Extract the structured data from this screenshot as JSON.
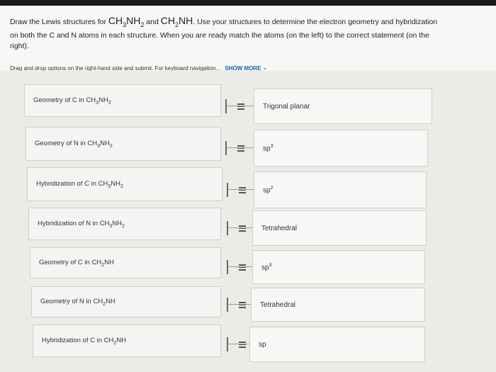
{
  "question": {
    "part1": "Draw the Lewis structures for ",
    "formula1_a": "CH",
    "formula1_sub1": "3",
    "formula1_b": "NH",
    "formula1_sub2": "2",
    "and": " and ",
    "formula2_a": "CH",
    "formula2_sub1": "2",
    "formula2_b": "NH",
    "part2": ". Use your structures to determine the electron geometry and hybridization on both the C and N atoms in each structure. When you are ready match the atoms (on the left) to the correct statement (on the right)."
  },
  "instructions": {
    "text": "Drag and drop options on the right-hand side and submit. For keyboard navigation...",
    "show_more": "SHOW MORE"
  },
  "rows": [
    {
      "label_pre": "Geometry of C in CH",
      "s1": "3",
      "mid": "NH",
      "s2": "2",
      "option": "Trigonal planar",
      "sup": ""
    },
    {
      "label_pre": "Geometry of N in CH",
      "s1": "3",
      "mid": "NH",
      "s2": "2",
      "option": "sp",
      "sup": "3"
    },
    {
      "label_pre": "Hybridization of C in CH",
      "s1": "3",
      "mid": "NH",
      "s2": "2",
      "option": "sp",
      "sup": "2"
    },
    {
      "label_pre": "Hybridization of N in CH",
      "s1": "3",
      "mid": "NH",
      "s2": "2",
      "option": "Tetrahedral",
      "sup": ""
    },
    {
      "label_pre": "Geometry of C in CH",
      "s1": "2",
      "mid": "NH",
      "s2": "",
      "option": "sp",
      "sup": "3"
    },
    {
      "label_pre": "Geometry of N in CH",
      "s1": "2",
      "mid": "NH",
      "s2": "",
      "option": "Tetrahedral",
      "sup": ""
    },
    {
      "label_pre": "Hybridization of C in CH",
      "s1": "2",
      "mid": "NH",
      "s2": "",
      "option": "sp",
      "sup": ""
    }
  ]
}
